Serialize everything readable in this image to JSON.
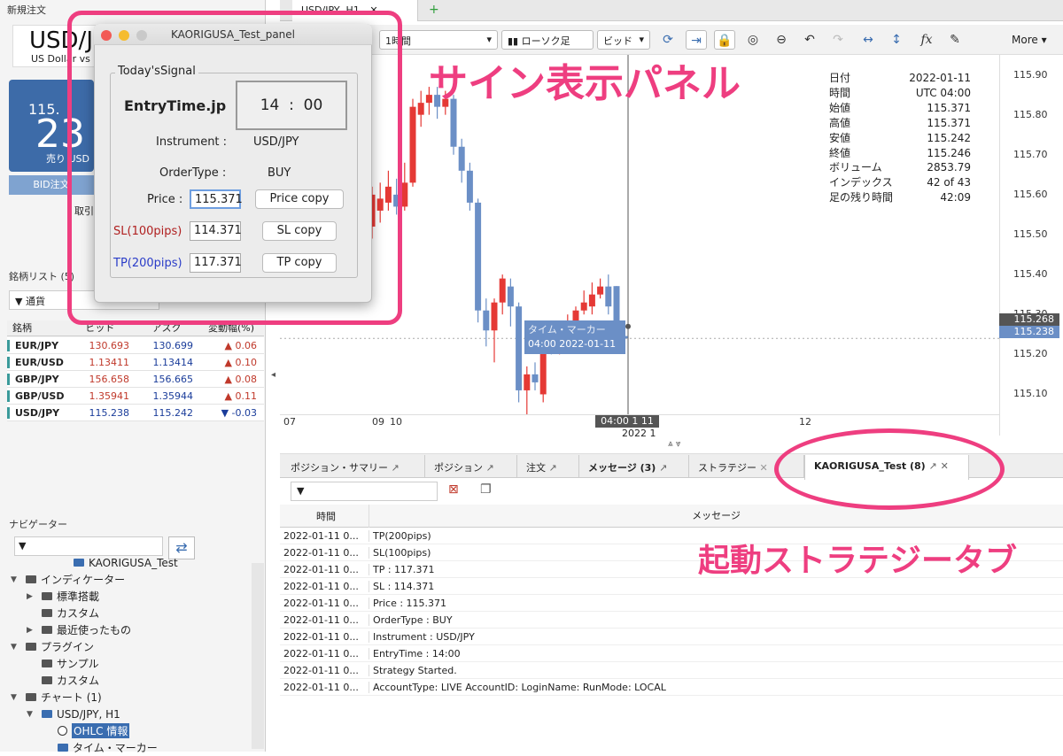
{
  "left": {
    "new_order_title": "新規注文",
    "symbol_big": "USD/JP",
    "symbol_desc": "US Dollar vs",
    "price_prefix": "115.",
    "price_big": "23",
    "sell_label": "売り USD",
    "bid_order_label": "BID注文",
    "trade_label": "取引",
    "watchlist_title": "銘柄リスト (5)",
    "filter_label": "通貨",
    "col_symbol": "銘柄",
    "col_bid": "ビッド",
    "col_ask": "アスク",
    "col_change": "変動幅(%)",
    "rows": [
      {
        "sym": "EUR/JPY",
        "bid": "130.693",
        "ask": "130.699",
        "chg": "0.06",
        "dir": "up"
      },
      {
        "sym": "EUR/USD",
        "bid": "1.13411",
        "ask": "1.13414",
        "chg": "0.10",
        "dir": "up"
      },
      {
        "sym": "GBP/JPY",
        "bid": "156.658",
        "ask": "156.665",
        "chg": "0.08",
        "dir": "up"
      },
      {
        "sym": "GBP/USD",
        "bid": "1.35941",
        "ask": "1.35944",
        "chg": "0.11",
        "dir": "up"
      },
      {
        "sym": "USD/JPY",
        "bid": "115.238",
        "ask": "115.242",
        "chg": "-0.03",
        "dir": "down"
      }
    ],
    "navigator_title": "ナビゲーター",
    "nav_items": [
      {
        "label": "KAORIGUSA_Test",
        "depth": 3
      },
      {
        "label": "インディケーター",
        "depth": 0
      },
      {
        "label": "標準搭載",
        "depth": 1
      },
      {
        "label": "カスタム",
        "depth": 1
      },
      {
        "label": "最近使ったもの",
        "depth": 1
      },
      {
        "label": "プラグイン",
        "depth": 0
      },
      {
        "label": "サンプル",
        "depth": 1
      },
      {
        "label": "カスタム",
        "depth": 1
      },
      {
        "label": "チャート (1)",
        "depth": 0
      },
      {
        "label": "USD/JPY, H1",
        "depth": 1
      },
      {
        "label": "OHLC 情報",
        "depth": 2
      },
      {
        "label": "タイム・マーカー",
        "depth": 2
      }
    ]
  },
  "chart_tab": "USD/JPY, H1",
  "toolbar": {
    "timeframe": "1時間",
    "chart_type": "ローソク足",
    "price_type": "ビッド",
    "more": "More",
    "fx_label": "fx"
  },
  "info_box": [
    {
      "k": "日付",
      "v": "2022-01-11"
    },
    {
      "k": "時間",
      "v": "UTC 04:00"
    },
    {
      "k": "始値",
      "v": "115.371"
    },
    {
      "k": "高値",
      "v": "115.371"
    },
    {
      "k": "安値",
      "v": "115.242"
    },
    {
      "k": "終値",
      "v": "115.246"
    },
    {
      "k": "ボリューム",
      "v": "2853.79"
    },
    {
      "k": "インデックス",
      "v": "42 of 43"
    },
    {
      "k": "足の残り時間",
      "v": "42:09"
    }
  ],
  "chart_data": {
    "type": "candlestick",
    "ylim": [
      115.05,
      115.95
    ],
    "y_ticks": [
      "115.90",
      "115.80",
      "115.70",
      "115.60",
      "115.50",
      "115.40",
      "115.30",
      "115.20",
      "115.10"
    ],
    "x_ticks": [
      "07",
      "09",
      "10",
      "12"
    ],
    "x_date_label": "2022 1",
    "price_labels": {
      "bid": "115.268",
      "ask": "115.238"
    },
    "time_marker": {
      "title": "タイム・マーカー",
      "value": "04:00 2022-01-11",
      "axis": "04:00 1 11"
    },
    "candles": [
      {
        "o": 115.52,
        "c": 115.6,
        "h": 115.62,
        "l": 115.49
      },
      {
        "o": 115.56,
        "c": 115.59,
        "h": 115.63,
        "l": 115.53
      },
      {
        "o": 115.58,
        "c": 115.62,
        "h": 115.66,
        "l": 115.56
      },
      {
        "o": 115.6,
        "c": 115.57,
        "h": 115.64,
        "l": 115.55
      },
      {
        "o": 115.57,
        "c": 115.63,
        "h": 115.68,
        "l": 115.56
      },
      {
        "o": 115.63,
        "c": 115.82,
        "h": 115.84,
        "l": 115.62
      },
      {
        "o": 115.8,
        "c": 115.83,
        "h": 115.86,
        "l": 115.77
      },
      {
        "o": 115.83,
        "c": 115.85,
        "h": 115.87,
        "l": 115.8
      },
      {
        "o": 115.85,
        "c": 115.82,
        "h": 115.87,
        "l": 115.79
      },
      {
        "o": 115.82,
        "c": 115.84,
        "h": 115.86,
        "l": 115.8
      },
      {
        "o": 115.84,
        "c": 115.72,
        "h": 115.85,
        "l": 115.7
      },
      {
        "o": 115.72,
        "c": 115.66,
        "h": 115.74,
        "l": 115.63
      },
      {
        "o": 115.66,
        "c": 115.58,
        "h": 115.68,
        "l": 115.56
      },
      {
        "o": 115.58,
        "c": 115.31,
        "h": 115.59,
        "l": 115.28
      },
      {
        "o": 115.31,
        "c": 115.26,
        "h": 115.34,
        "l": 115.22
      },
      {
        "o": 115.26,
        "c": 115.33,
        "h": 115.34,
        "l": 115.18
      },
      {
        "o": 115.33,
        "c": 115.39,
        "h": 115.4,
        "l": 115.3
      },
      {
        "o": 115.37,
        "c": 115.32,
        "h": 115.39,
        "l": 115.27
      },
      {
        "o": 115.32,
        "c": 115.11,
        "h": 115.33,
        "l": 115.08
      },
      {
        "o": 115.11,
        "c": 115.15,
        "h": 115.17,
        "l": 115.05
      },
      {
        "o": 115.15,
        "c": 115.13,
        "h": 115.18,
        "l": 115.11
      },
      {
        "o": 115.1,
        "c": 115.23,
        "h": 115.25,
        "l": 115.08
      },
      {
        "o": 115.23,
        "c": 115.22,
        "h": 115.24,
        "l": 115.2
      },
      {
        "o": 115.22,
        "c": 115.27,
        "h": 115.28,
        "l": 115.2
      },
      {
        "o": 115.25,
        "c": 115.28,
        "h": 115.3,
        "l": 115.24
      },
      {
        "o": 115.27,
        "c": 115.31,
        "h": 115.32,
        "l": 115.25
      },
      {
        "o": 115.31,
        "c": 115.33,
        "h": 115.36,
        "l": 115.3
      },
      {
        "o": 115.32,
        "c": 115.35,
        "h": 115.38,
        "l": 115.3
      },
      {
        "o": 115.35,
        "c": 115.37,
        "h": 115.39,
        "l": 115.34
      },
      {
        "o": 115.37,
        "c": 115.32,
        "h": 115.4,
        "l": 115.3
      },
      {
        "o": 115.371,
        "c": 115.246,
        "h": 115.371,
        "l": 115.242
      },
      {
        "o": 115.246,
        "c": 115.24,
        "h": 115.25,
        "l": 115.23
      }
    ]
  },
  "bottom_tabs": [
    "ポジション・サマリー",
    "ポジション",
    "注文",
    "メッセージ (3)",
    "ストラテジー",
    "KAORIGUSA_Test (8)"
  ],
  "messages": {
    "col_time": "時間",
    "col_msg": "メッセージ",
    "rows": [
      {
        "t": "2022-01-11 0...",
        "m": "TP(200pips)"
      },
      {
        "t": "2022-01-11 0...",
        "m": "SL(100pips)"
      },
      {
        "t": "2022-01-11 0...",
        "m": "TP : 117.371"
      },
      {
        "t": "2022-01-11 0...",
        "m": "SL : 114.371"
      },
      {
        "t": "2022-01-11 0...",
        "m": "Price : 115.371"
      },
      {
        "t": "2022-01-11 0...",
        "m": "OrderType : BUY"
      },
      {
        "t": "2022-01-11 0...",
        "m": "Instrument : USD/JPY"
      },
      {
        "t": "2022-01-11 0...",
        "m": "EntryTime : 14:00"
      },
      {
        "t": "2022-01-11 0...",
        "m": "Strategy Started."
      },
      {
        "t": "2022-01-11 0...",
        "m": "AccountType: LIVE AccountID:  LoginName:  RunMode: LOCAL"
      }
    ]
  },
  "panel": {
    "title": "KAORIGUSA_Test_panel",
    "group_title": "Today'sSignal",
    "entry_label": "EntryTime.jp",
    "entry_time": "14  :  00",
    "instrument_label": "Instrument :",
    "instrument_value": "USD/JPY",
    "ordertype_label": "OrderType :",
    "ordertype_value": "BUY",
    "price_label": "Price :",
    "price_value": "115.371",
    "price_btn": "Price copy",
    "sl_label": "SL(100pips)",
    "sl_value": "114.371",
    "sl_btn": "SL copy",
    "tp_label": "TP(200pips)",
    "tp_value": "117.371",
    "tp_btn": "TP copy"
  },
  "annotations": {
    "panel_caption": "サイン表示パネル",
    "tab_caption": "起動ストラテジータブ"
  },
  "colors": {
    "accent": "#ee3e80",
    "bull": "#e53935",
    "bear": "#6b8fc6"
  }
}
